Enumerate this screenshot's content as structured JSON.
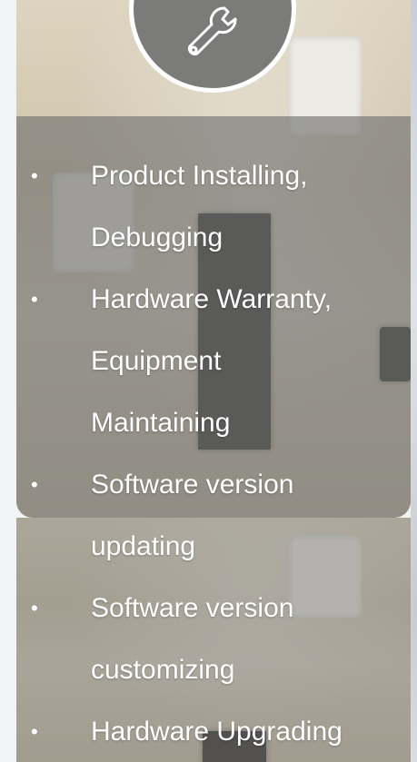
{
  "services": [
    {
      "lines": [
        "Product Installing,",
        "Debugging"
      ]
    },
    {
      "lines": [
        "Hardware Warranty,",
        "Equipment",
        "Maintaining"
      ]
    },
    {
      "lines": [
        "Software version",
        "updating"
      ]
    },
    {
      "lines": [
        "Software version",
        "customizing"
      ]
    },
    {
      "lines": [
        "Hardware Upgrading"
      ]
    }
  ],
  "icons": {
    "header_icon": "wrench-icon",
    "bullet": "•"
  },
  "colors": {
    "text": "#ffffff",
    "icon_circle": "#7b7b7a",
    "overlay": "#6e6e6c"
  }
}
